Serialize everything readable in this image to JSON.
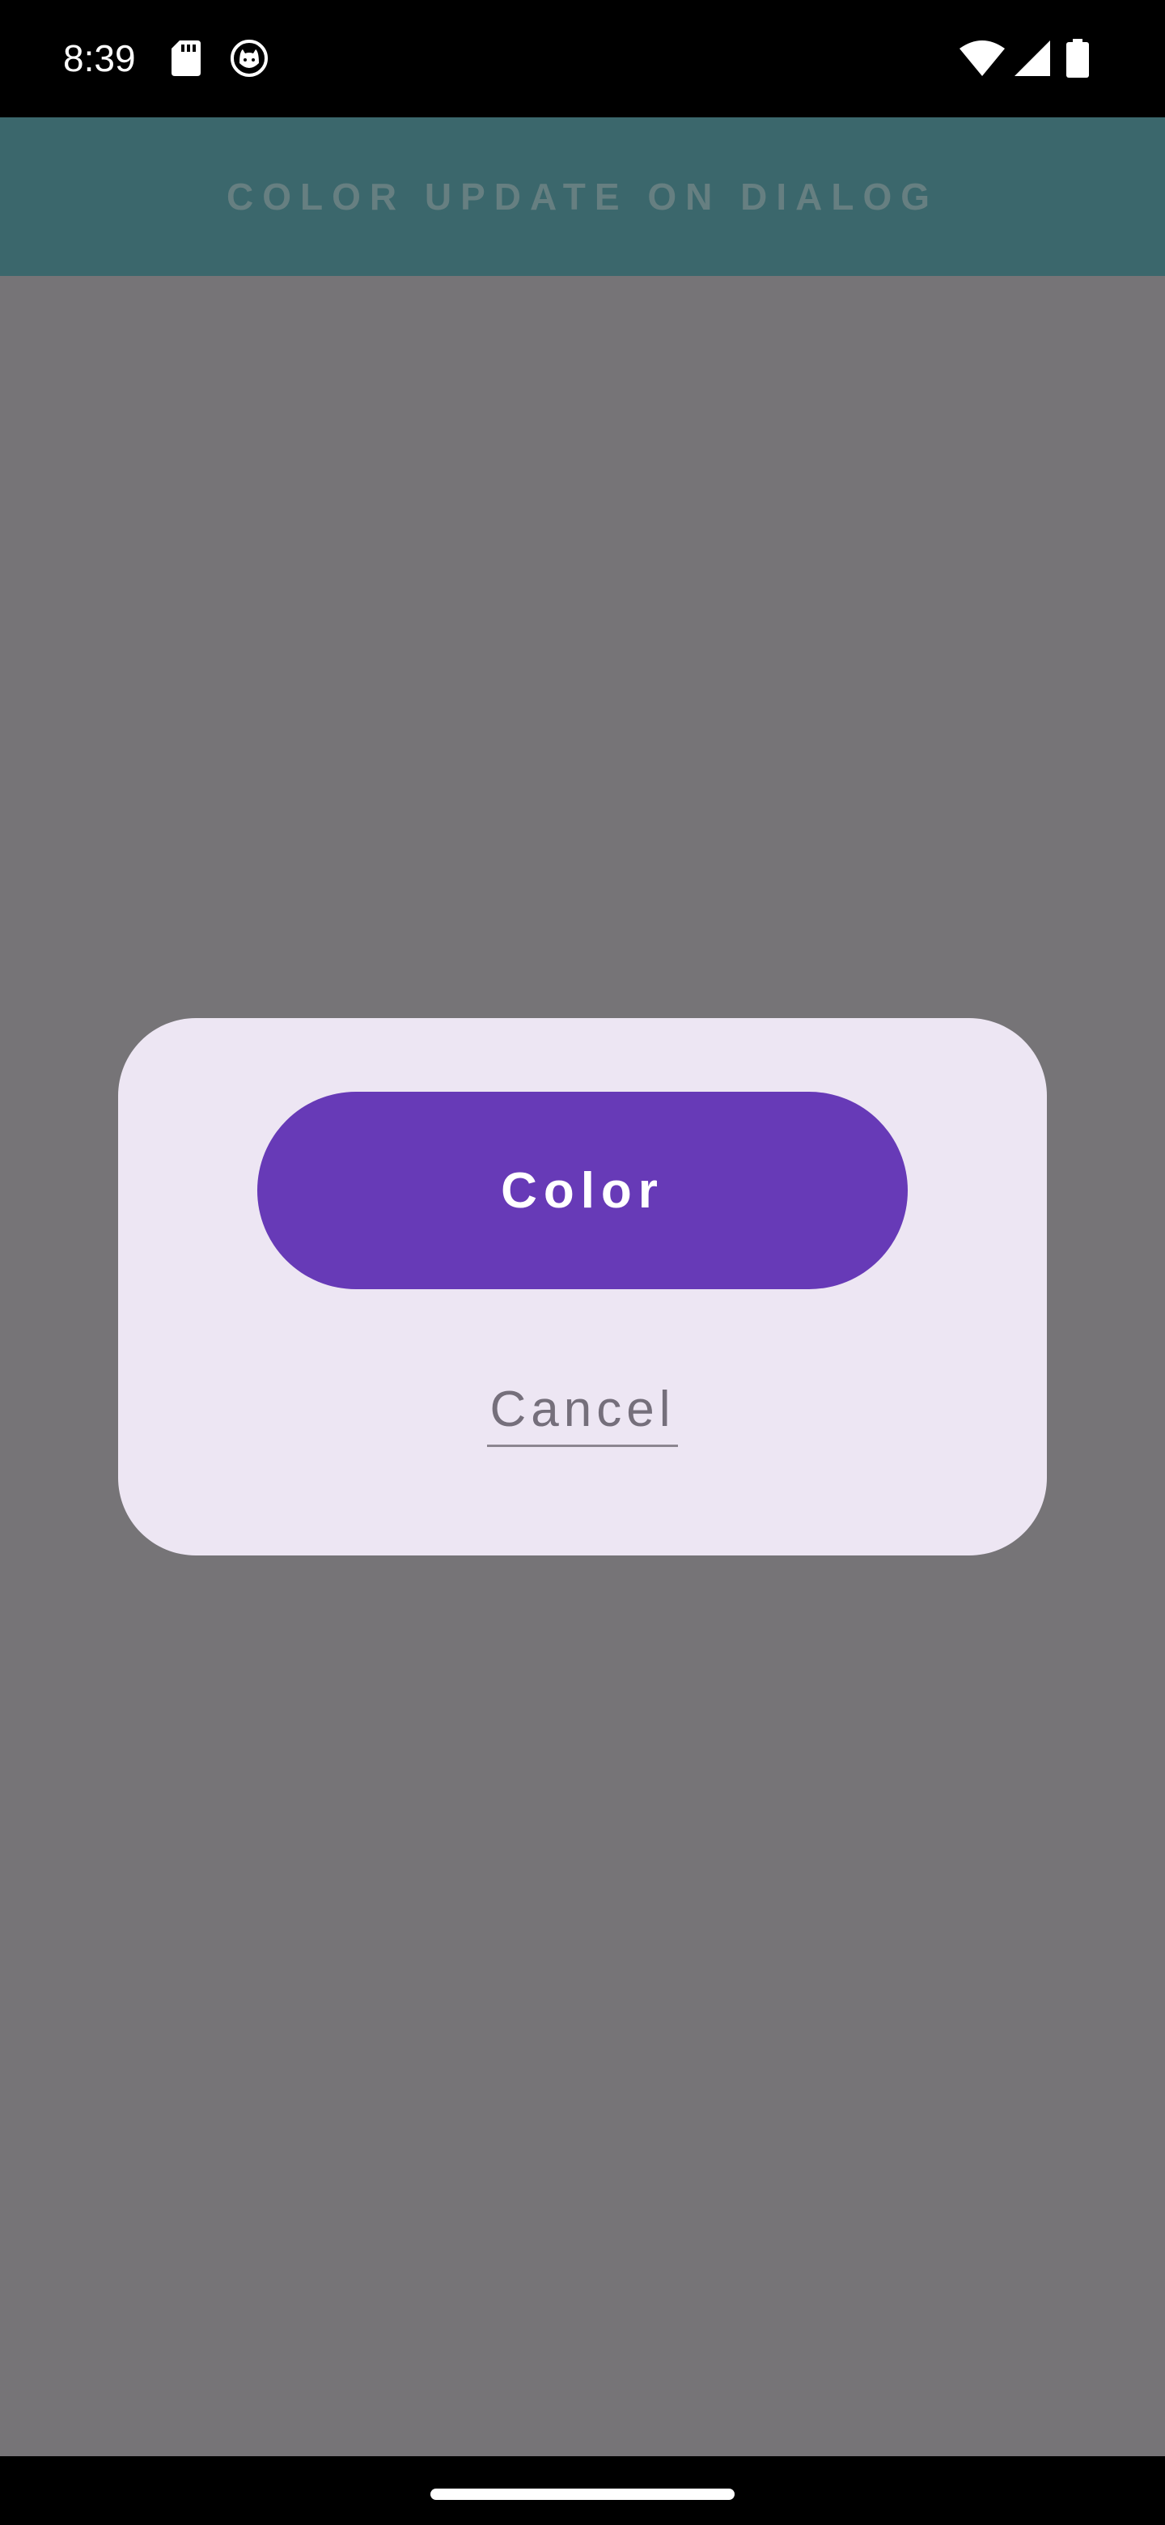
{
  "status_bar": {
    "time": "8:39",
    "icons": [
      "sd-card-icon",
      "cat-icon",
      "wifi-icon",
      "signal-icon",
      "battery-icon"
    ]
  },
  "app_bar": {
    "title": "COLOR UPDATE ON DIALOG",
    "background": "#3b676c"
  },
  "dialog": {
    "primary_button_label": "Color",
    "secondary_button_label": "Cancel",
    "primary_color": "#673ab7",
    "background": "#ede6f3"
  },
  "colors": {
    "scrim": "#767477",
    "system_bars": "#000000"
  }
}
